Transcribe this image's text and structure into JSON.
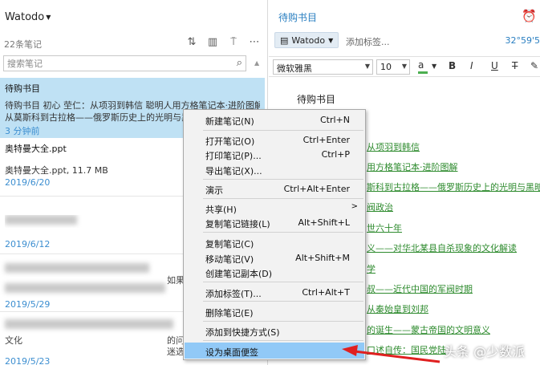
{
  "sidebar": {
    "notebook": "Watodo",
    "count_label": "22条笔记",
    "search_placeholder": "搜索笔记"
  },
  "notes": [
    {
      "title": "待购书目",
      "snippet_line1": "待购书目 初心 茔仁：从项羽到韩信 聪明人用方格笔记本·进阶图解",
      "snippet_line2": "从莫斯科到古拉格——俄罗斯历史上的光明与黑暗",
      "time": "3 分钟前"
    },
    {
      "title": "奥特曼大全.ppt",
      "snippet_line1": "奥特曼大全.ppt, 11.7 MB",
      "time": "2019/6/20"
    },
    {
      "time": "2019/6/12"
    },
    {
      "fragment": "如果",
      "time": "2019/5/29"
    },
    {
      "fragment1": "文化",
      "fragment2": "的问",
      "fragment3": "迷选",
      "time": "2019/5/23"
    }
  ],
  "editor": {
    "title": "待购书目",
    "notebook": "Watodo",
    "add_tag": "添加标签...",
    "coord": "32°59'5",
    "font": "微软雅黑",
    "size": "10",
    "doc_title": "待购书目",
    "links": [
      "从项羽到韩信",
      "用方格笔记本·进阶图解",
      "斯科到古拉格——俄罗斯历史上的光明与黑暗",
      "阀政治",
      "世六十年",
      "义——对华北某县自杀现象的文化解读",
      "学",
      "叔——近代中国的军阀时期",
      "从秦始皇到刘邦",
      "的诞生——蒙古帝国的文明意义",
      "口述自传：国民党陆"
    ]
  },
  "context_menu": {
    "items": [
      {
        "label": "新建笔记(N)",
        "shortcut": "Ctrl+N"
      },
      {
        "label": "打开笔记(O)",
        "shortcut": "Ctrl+Enter"
      },
      {
        "label": "打印笔记(P)...",
        "shortcut": "Ctrl+P"
      },
      {
        "label": "导出笔记(X)...",
        "shortcut": ""
      },
      {
        "label": "演示",
        "shortcut": "Ctrl+Alt+Enter"
      },
      {
        "label": "共享(H)",
        "shortcut": ""
      },
      {
        "label": "复制笔记链接(L)",
        "shortcut": "Alt+Shift+L"
      },
      {
        "label": "复制笔记(C)",
        "shortcut": ""
      },
      {
        "label": "移动笔记(V)",
        "shortcut": "Alt+Shift+M"
      },
      {
        "label": "创建笔记副本(D)",
        "shortcut": ""
      },
      {
        "label": "添加标签(T)...",
        "shortcut": "Ctrl+Alt+T"
      },
      {
        "label": "删除笔记(E)",
        "shortcut": ""
      },
      {
        "label": "添加到快捷方式(S)",
        "shortcut": ""
      },
      {
        "label": "设为桌面便签",
        "shortcut": ""
      }
    ]
  },
  "watermark": "头条 @少数派",
  "colors": {
    "highlight": "#91c9f7",
    "selected_note": "#bfe1f4",
    "link": "#2e8b2e",
    "accent": "#2a7fc1",
    "arrow": "#e02020"
  }
}
